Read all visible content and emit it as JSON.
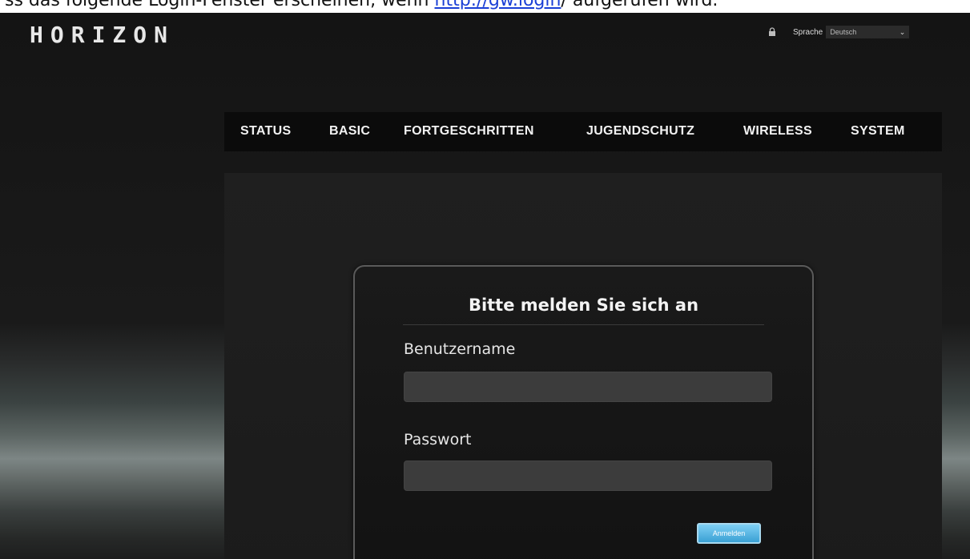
{
  "caption": {
    "lead_text": "ss das folgende Login-Fenster erscheinen, wenn ",
    "link_text": "http://gw.login",
    "tail_text": "/ aufgerufen wird."
  },
  "header": {
    "logo_text": "HORIZON",
    "language_label": "Sprache",
    "language_value": "Deutsch",
    "lock_icon": "lock-icon",
    "chevron_icon": "chevron-down-icon"
  },
  "nav": {
    "items": [
      {
        "label": "STATUS"
      },
      {
        "label": "BASIC"
      },
      {
        "label": "FORTGESCHRITTEN"
      },
      {
        "label": "JUGENDSCHUTZ"
      },
      {
        "label": "WIRELESS"
      },
      {
        "label": "SYSTEM"
      }
    ]
  },
  "login": {
    "title": "Bitte melden Sie sich an",
    "username_label": "Benutzername",
    "username_value": "",
    "password_label": "Passwort",
    "password_value": "",
    "button_label": "Anmelden"
  },
  "colors": {
    "accent_button": "#3aa0d4",
    "navbar": "#0b0b0b",
    "page_background": "#1c1c1c"
  }
}
